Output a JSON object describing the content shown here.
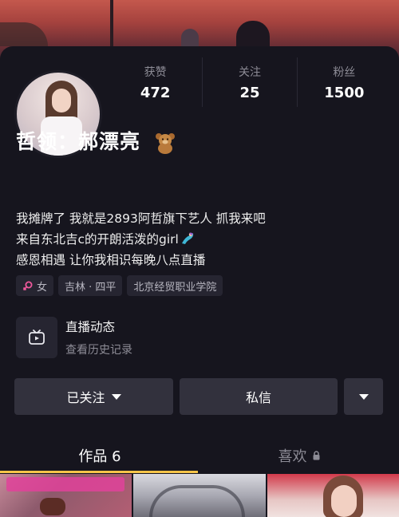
{
  "profile": {
    "name": "哲领：郝漂亮",
    "name_emoji_icon": "teddy-bear-icon",
    "stats": [
      {
        "label": "获赞",
        "value": "472"
      },
      {
        "label": "关注",
        "value": "25"
      },
      {
        "label": "粉丝",
        "value": "1500"
      }
    ],
    "bio_lines": [
      "我摊牌了 我就是2893阿哲旗下艺人 抓我来吧",
      "来自东北吉c的开朗活泼的girl",
      "感恩相遇 让你我相识每晚八点直播"
    ],
    "bio_line2_emoji_icon": "mermaid-icon",
    "tags": [
      {
        "icon": "female-icon",
        "label": "女"
      },
      {
        "label": "吉林 · 四平"
      },
      {
        "label": "北京经贸职业学院"
      }
    ]
  },
  "live": {
    "title": "直播动态",
    "subtitle": "查看历史记录",
    "icon": "tv-icon"
  },
  "actions": {
    "follow_label": "已关注",
    "message_label": "私信"
  },
  "tabs": [
    {
      "label": "作品 6",
      "active": true
    },
    {
      "label": "喜欢",
      "locked": true,
      "active": false
    }
  ],
  "colors": {
    "background": "#16151e",
    "button": "#32313d",
    "tag": "#262531",
    "tab_indicator": "#f6c549",
    "gender_pink": "#f0589c"
  }
}
